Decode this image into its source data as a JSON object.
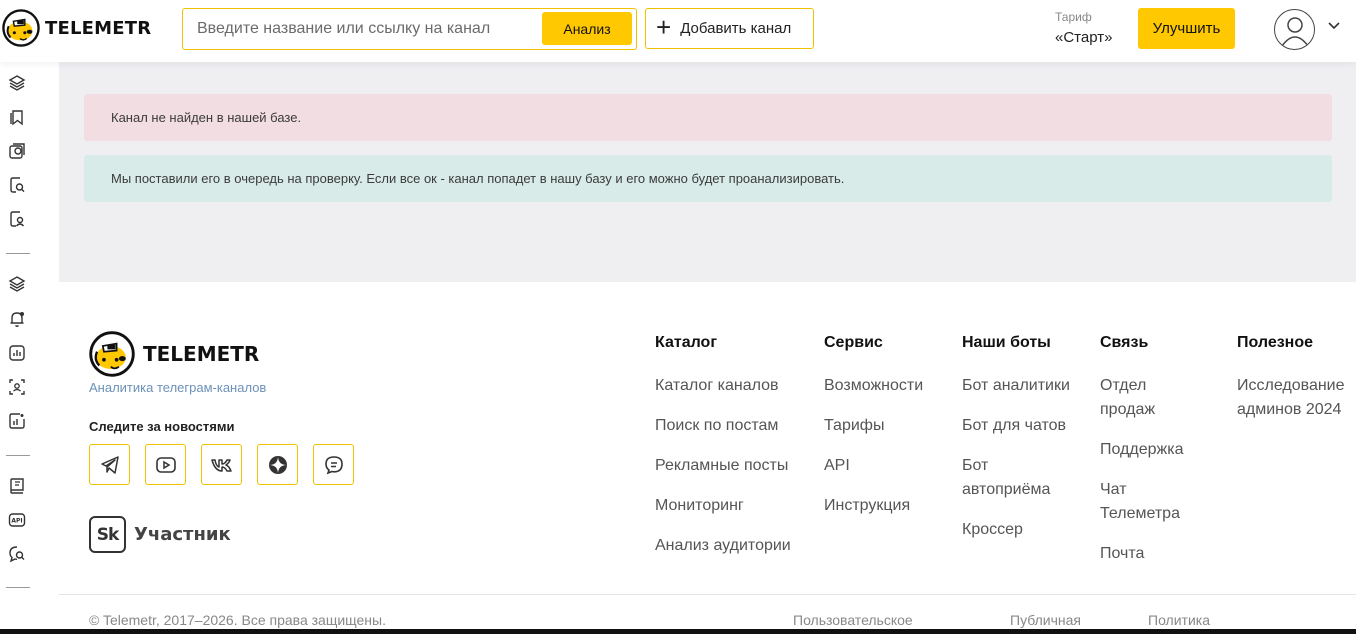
{
  "header": {
    "brand": "TELEMETR",
    "search_placeholder": "Введите название или ссылку на канал",
    "analyze_label": "Анализ",
    "add_channel_label": "Добавить канал",
    "tariff_label": "Тариф",
    "tariff_value": "«Старт»",
    "upgrade_label": "Улучшить"
  },
  "sidebar": {
    "icons": [
      "layers-icon",
      "bookmarks-icon",
      "star-search-icon",
      "file-search-icon",
      "file-user-icon",
      "layers-icon",
      "bell-icon",
      "chart-icon",
      "user-scan-icon",
      "stats-info-icon",
      "book-icon",
      "api-icon",
      "chat-search-icon"
    ]
  },
  "alerts": {
    "danger": "Канал не найден в нашей базе.",
    "info": "Мы поставили его в очередь на проверку. Если все ок - канал попадет в нашу базу и его можно будет проанализировать."
  },
  "footer": {
    "brand": "TELEMETR",
    "tagline": "Аналитика телеграм-каналов",
    "follow_label": "Следите за новостями",
    "socials": [
      "telegram-icon",
      "youtube-icon",
      "vk-icon",
      "dzen-icon",
      "chat-icon"
    ],
    "sk_badge": "Sk",
    "sk_label": "Участник",
    "columns": [
      {
        "title": "Каталог",
        "links": [
          "Каталог каналов",
          "Поиск по постам",
          "Рекламные посты",
          "Мониторинг",
          "Анализ аудитории"
        ]
      },
      {
        "title": "Сервис",
        "links": [
          "Возможности",
          "Тарифы",
          "API",
          "Инструкция"
        ]
      },
      {
        "title": "Наши боты",
        "links": [
          "Бот аналитики",
          "Бот для чатов",
          "Бот автоприёма",
          "Кроссер"
        ]
      },
      {
        "title": "Связь",
        "links": [
          "Отдел продаж",
          "Поддержка",
          "Чат Телеметра",
          "Почта"
        ]
      },
      {
        "title": "Полезное",
        "links": [
          "Исследование админов 2024"
        ]
      }
    ],
    "copyright": "© Telemetr, 2017–2026. Все права защищены.",
    "bottom_links": [
      "Пользовательское",
      "Публичная",
      "Политика"
    ]
  },
  "colors": {
    "accent": "#ffc800",
    "danger_bg": "#f2dde2",
    "info_bg": "#d8ebe8",
    "main_bg": "#efeff2"
  }
}
